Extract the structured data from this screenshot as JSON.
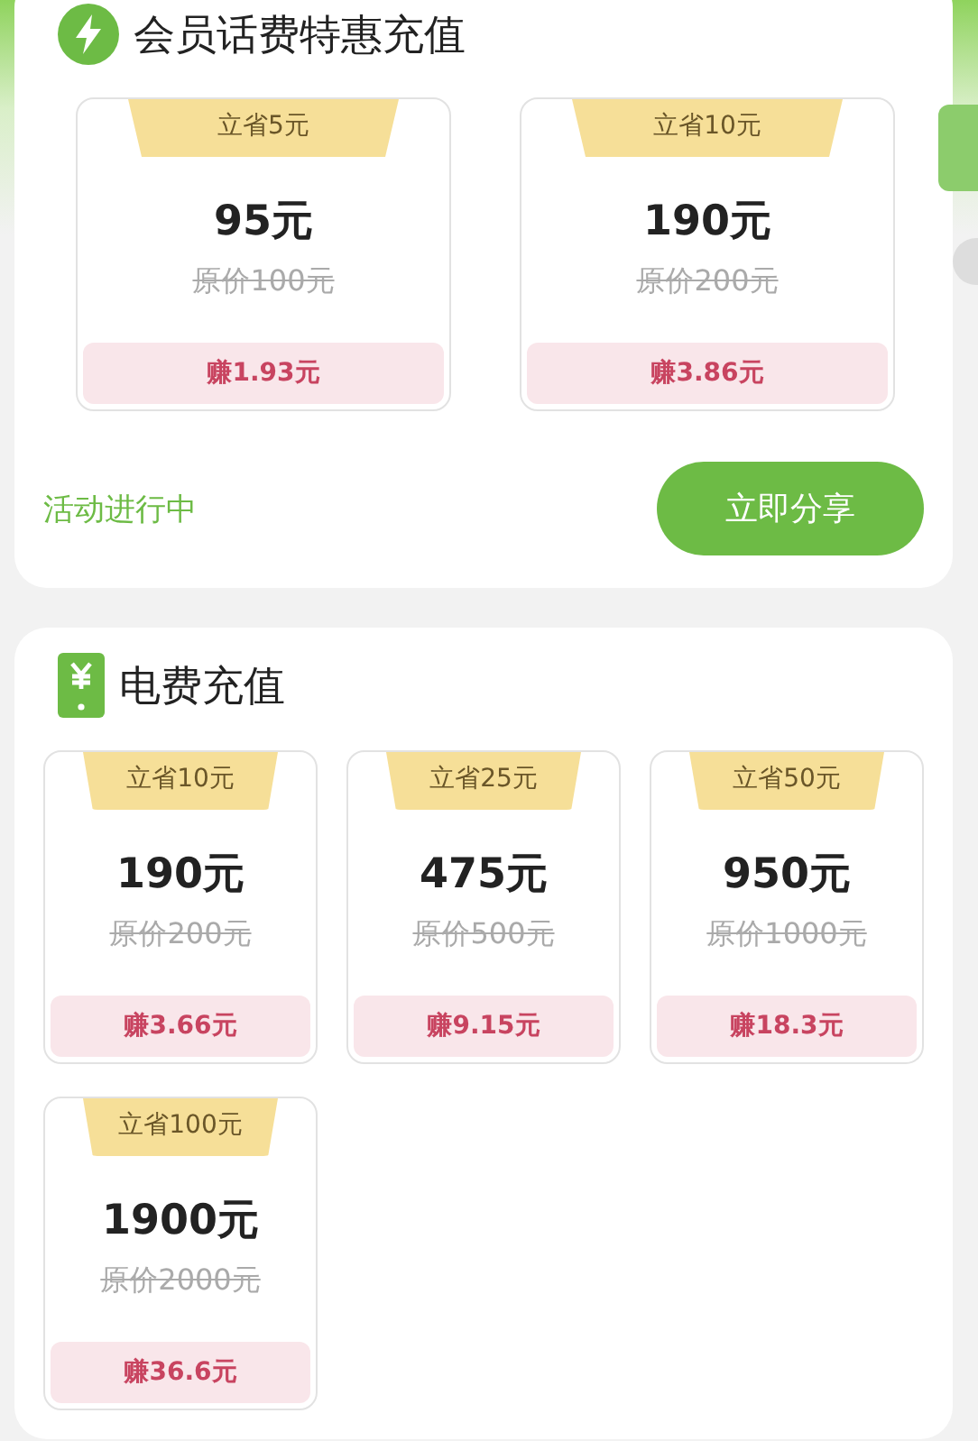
{
  "sections": [
    {
      "title": "会员话费特惠充值",
      "products": [
        {
          "badge": "立省5元",
          "price": "95元",
          "original": "原价100元",
          "earn": "赚1.93元"
        },
        {
          "badge": "立省10元",
          "price": "190元",
          "original": "原价200元",
          "earn": "赚3.86元"
        }
      ],
      "status": "活动进行中",
      "button": "立即分享"
    },
    {
      "title": "电费充值",
      "products": [
        {
          "badge": "立省10元",
          "price": "190元",
          "original": "原价200元",
          "earn": "赚3.66元"
        },
        {
          "badge": "立省25元",
          "price": "475元",
          "original": "原价500元",
          "earn": "赚9.15元"
        },
        {
          "badge": "立省50元",
          "price": "950元",
          "original": "原价1000元",
          "earn": "赚18.3元"
        },
        {
          "badge": "立省100元",
          "price": "1900元",
          "original": "原价2000元",
          "earn": "赚36.6元"
        }
      ]
    }
  ]
}
